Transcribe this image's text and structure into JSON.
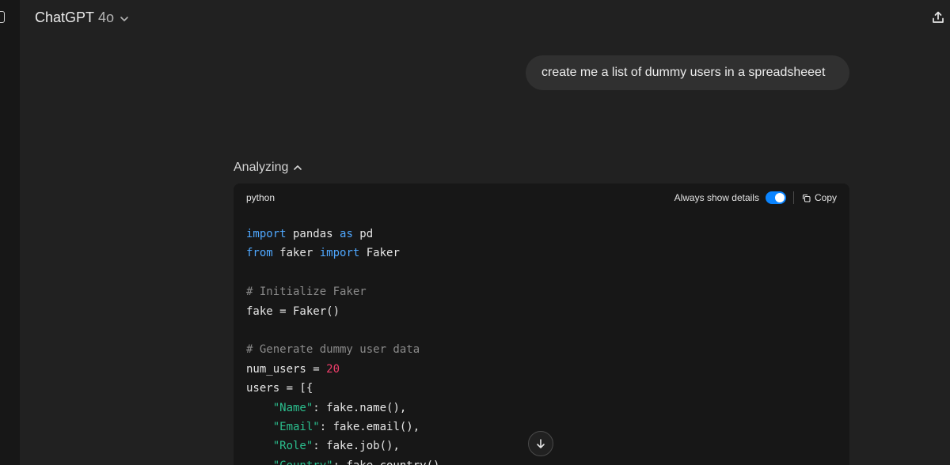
{
  "header": {
    "model_name": "ChatGPT",
    "model_version": "4o"
  },
  "user_message": "create me a list of dummy users in a spreadsheeet",
  "assistant": {
    "status_label": "Analyzing",
    "code_block": {
      "language": "python",
      "details_label": "Always show details",
      "details_toggle_on": true,
      "copy_label": "Copy",
      "lines": [
        [
          {
            "t": "import",
            "c": "kw"
          },
          {
            "t": " pandas ",
            "c": ""
          },
          {
            "t": "as",
            "c": "kw"
          },
          {
            "t": " pd",
            "c": ""
          }
        ],
        [
          {
            "t": "from",
            "c": "kw"
          },
          {
            "t": " faker ",
            "c": ""
          },
          {
            "t": "import",
            "c": "kw"
          },
          {
            "t": " Faker",
            "c": ""
          }
        ],
        [],
        [
          {
            "t": "# Initialize Faker",
            "c": "cm"
          }
        ],
        [
          {
            "t": "fake = Faker()",
            "c": ""
          }
        ],
        [],
        [
          {
            "t": "# Generate dummy user data",
            "c": "cm"
          }
        ],
        [
          {
            "t": "num_users = ",
            "c": ""
          },
          {
            "t": "20",
            "c": "num"
          }
        ],
        [
          {
            "t": "users = [{",
            "c": ""
          }
        ],
        [
          {
            "t": "    ",
            "c": ""
          },
          {
            "t": "\"Name\"",
            "c": "str"
          },
          {
            "t": ": fake.name(),",
            "c": ""
          }
        ],
        [
          {
            "t": "    ",
            "c": ""
          },
          {
            "t": "\"Email\"",
            "c": "str"
          },
          {
            "t": ": fake.email(),",
            "c": ""
          }
        ],
        [
          {
            "t": "    ",
            "c": ""
          },
          {
            "t": "\"Role\"",
            "c": "str"
          },
          {
            "t": ": fake.job(),",
            "c": ""
          }
        ],
        [
          {
            "t": "    ",
            "c": ""
          },
          {
            "t": "\"Country\"",
            "c": "str"
          },
          {
            "t": ": fake.country(),",
            "c": ""
          }
        ]
      ]
    }
  },
  "icons": {
    "sidebar_toggle": "sidebar-toggle-icon",
    "model_chevron": "chevron-down-icon",
    "share": "share-icon",
    "analyzing_chevron": "chevron-up-icon",
    "copy": "copy-icon",
    "scroll_down": "arrow-down-icon"
  },
  "colors": {
    "background": "#212121",
    "bubble": "#303030",
    "code_background": "#171717",
    "toggle_on": "#0a84ff",
    "keyword": "#4fa8ff",
    "comment": "#8a8a8a",
    "number": "#f03e6b",
    "string": "#2bbf8e"
  }
}
